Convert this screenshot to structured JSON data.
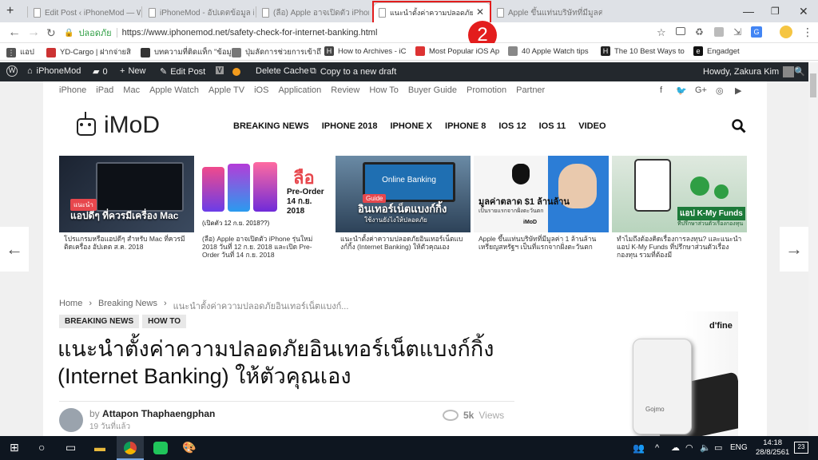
{
  "browser": {
    "tabs": [
      {
        "title": "Edit Post ‹ iPhoneMod — Wo"
      },
      {
        "title": "iPhoneMod - อัปเดตข้อมูล iPh"
      },
      {
        "title": "(ลือ) Apple อาจเปิดตัว iPhone"
      },
      {
        "title": "แนะนำตั้งค่าความปลอดภัยอิน"
      },
      {
        "title": "Apple ขึ้นแท่นบริษัทที่มีมูลค่า 1 ..."
      }
    ],
    "annotation_number": "2",
    "address": {
      "secure_label": "ปลอดภัย",
      "url": "https://www.iphonemod.net/safety-check-for-internet-banking.html"
    },
    "bookmarks": [
      {
        "label": "แอป",
        "icon": "apps-icon"
      },
      {
        "label": "YD-Cargo | ฝากจ่ายสิ"
      },
      {
        "label": "บทความที่ติดแท็ก \"ข้อมู"
      },
      {
        "label": "ปุ่มลัดการช่วยการเข้าถึ"
      },
      {
        "label": "How to Archives - iC"
      },
      {
        "label": "Most Popular iOS Ap"
      },
      {
        "label": "40 Apple Watch tips"
      },
      {
        "label": "The 10 Best Ways to"
      },
      {
        "label": "Engadget"
      }
    ]
  },
  "wpadmin": {
    "site": "iPhoneMod",
    "comments": "0",
    "new": "New",
    "edit": "Edit Post",
    "v": "V",
    "cache": "Delete Cache",
    "draft": "Copy to a new draft",
    "howdy": "Howdy, Zakura Kim"
  },
  "site": {
    "topnav": [
      "iPhone",
      "iPad",
      "Mac",
      "Apple Watch",
      "Apple TV",
      "iOS",
      "Application",
      "Review",
      "How To",
      "Buyer Guide",
      "Promotion",
      "Partner"
    ],
    "social": [
      "f",
      "🐦",
      "G+",
      "◎",
      "▶"
    ],
    "logo": "iMoD",
    "mainnav": [
      "BREAKING NEWS",
      "IPHONE 2018",
      "IPHONE X",
      "IPHONE 8",
      "IOS 12",
      "IOS 11",
      "VIDEO"
    ],
    "cards": [
      {
        "overlay": "แอปดีๆ ที่ควรมีเครื่อง Mac",
        "tag": "แนะนำ",
        "caption": "โปรแกรมหรือแอปดีๆ สำหรับ Mac ที่ควรมีติดเครื่อง อัปเดต ส.ค. 2018"
      },
      {
        "overlay": "ลือ",
        "sub": "Pre-Order 14 ก.ย. 2018",
        "note": "(เปิดตัว 12 ก.ย. 2018??)",
        "caption": "(ลือ) Apple อาจเปิดตัว iPhone รุ่นใหม่ 2018 วันที่ 12 ก.ย. 2018 และเปิด Pre-Order วันที่ 14 ก.ย. 2018"
      },
      {
        "overlay": "อินเทอร์เน็ตแบงก์กิ้ง",
        "sub": "ใช้งานยังไงให้ปลอดภัย",
        "screen": "Online Banking",
        "tag": "Guide",
        "caption": "แนะนำตั้งค่าความปลอดภัยอินเทอร์เน็ตแบงก์กิ้ง (Internet Banking) ให้ตัวคุณเอง"
      },
      {
        "overlay": "มูลค่าตลาด $1 ล้านล้าน",
        "sub": "เป็นรายแรกจากฝั่งตะวันตก",
        "brand": "iMoD",
        "caption": "Apple ขึ้นแท่นบริษัทที่มีมูลค่า 1 ล้านล้านเหรียญสหรัฐฯ เป็นที่แรกจากฝั่งตะวันตก"
      },
      {
        "overlay": "แอป K-My Funds",
        "sub": "ที่ปรึกษาส่วนตัวเรื่องกองทุน",
        "caption": "ทำไมถึงต้องคิดเรื่องการลงทุน? และแนะนำแอป K-My Funds ที่ปรึกษาส่วนตัวเรื่องกองทุน รวมที่ต้องมี"
      }
    ],
    "breadcrumb": [
      "Home",
      "›",
      "Breaking News",
      "›",
      "แนะนำตั้งค่าความปลอดภัยอินเทอร์เน็ตแบงก์..."
    ],
    "tags": [
      "BREAKING NEWS",
      "HOW TO"
    ],
    "title": "แนะนำตั้งค่าความปลอดภัยอินเทอร์เน็ตแบงก์กิ้ง (Internet Banking) ให้ตัวคุณเอง",
    "author_by": "by",
    "author": "Attapon Thaphaengphan",
    "date": "19 วันที่แล้ว",
    "views": "5k",
    "views_label": "Views",
    "ad_brand": "d'fine",
    "ad_device": "Gojmo"
  },
  "taskbar": {
    "lang": "ENG",
    "time": "14:18",
    "date": "28/8/2561",
    "notif": "23"
  }
}
